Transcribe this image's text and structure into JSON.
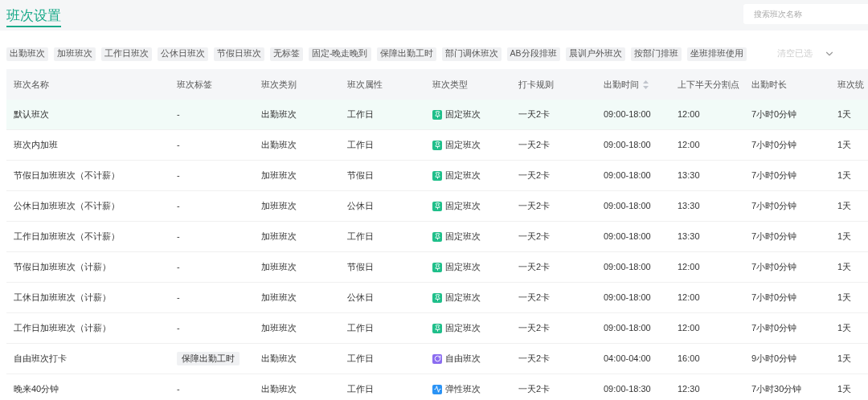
{
  "page_title": "班次设置",
  "search": {
    "placeholder": "搜索班次名称"
  },
  "filter_tags": [
    "出勤班次",
    "加班班次",
    "工作日班次",
    "公休日班次",
    "节假日班次",
    "无标签",
    "固定-晚走晚到",
    "保障出勤工时",
    "部门调休班次",
    "AB分段排班",
    "晨训户外班次",
    "按部门排班",
    "坐班排班使用"
  ],
  "clear_button": {
    "label": "清空已选",
    "disabled": true
  },
  "table": {
    "columns": [
      {
        "label": "班次名称",
        "sortable": false
      },
      {
        "label": "班次标签",
        "sortable": false
      },
      {
        "label": "班次类别",
        "sortable": false
      },
      {
        "label": "班次属性",
        "sortable": false
      },
      {
        "label": "班次类型",
        "sortable": false
      },
      {
        "label": "打卡规则",
        "sortable": false
      },
      {
        "label": "出勤时间",
        "sortable": true
      },
      {
        "label": "上下半天分割点",
        "sortable": false
      },
      {
        "label": "出勤时长",
        "sortable": false
      },
      {
        "label": "班次统",
        "sortable": false
      }
    ],
    "rows": [
      {
        "highlighted": true,
        "name": "默认班次",
        "tag": "-",
        "category": "出勤班次",
        "attribute": "工作日",
        "type": {
          "kind": "fixed",
          "label": "固定班次"
        },
        "rule": "一天2卡",
        "time": "09:00-18:00",
        "split": "12:00",
        "duration": "7小时0分钟",
        "stat": "1天"
      },
      {
        "highlighted": false,
        "name": "班次内加班",
        "tag": "-",
        "category": "出勤班次",
        "attribute": "工作日",
        "type": {
          "kind": "fixed",
          "label": "固定班次"
        },
        "rule": "一天2卡",
        "time": "09:00-18:00",
        "split": "12:00",
        "duration": "7小时0分钟",
        "stat": "1天"
      },
      {
        "highlighted": false,
        "name": "节假日加班班次（不计薪）",
        "tag": "-",
        "category": "加班班次",
        "attribute": "节假日",
        "type": {
          "kind": "fixed",
          "label": "固定班次"
        },
        "rule": "一天2卡",
        "time": "09:00-18:00",
        "split": "13:30",
        "duration": "7小时0分钟",
        "stat": "1天"
      },
      {
        "highlighted": false,
        "name": "公休日加班班次（不计薪）",
        "tag": "-",
        "category": "加班班次",
        "attribute": "公休日",
        "type": {
          "kind": "fixed",
          "label": "固定班次"
        },
        "rule": "一天2卡",
        "time": "09:00-18:00",
        "split": "13:30",
        "duration": "7小时0分钟",
        "stat": "1天"
      },
      {
        "highlighted": false,
        "name": "工作日加班班次（不计薪）",
        "tag": "-",
        "category": "加班班次",
        "attribute": "工作日",
        "type": {
          "kind": "fixed",
          "label": "固定班次"
        },
        "rule": "一天2卡",
        "time": "09:00-18:00",
        "split": "13:30",
        "duration": "7小时0分钟",
        "stat": "1天"
      },
      {
        "highlighted": false,
        "name": "节假日加班班次（计薪）",
        "tag": "-",
        "category": "加班班次",
        "attribute": "节假日",
        "type": {
          "kind": "fixed",
          "label": "固定班次"
        },
        "rule": "一天2卡",
        "time": "09:00-18:00",
        "split": "12:00",
        "duration": "7小时0分钟",
        "stat": "1天"
      },
      {
        "highlighted": false,
        "name": "工休日加班班次（计薪）",
        "tag": "-",
        "category": "加班班次",
        "attribute": "公休日",
        "type": {
          "kind": "fixed",
          "label": "固定班次"
        },
        "rule": "一天2卡",
        "time": "09:00-18:00",
        "split": "12:00",
        "duration": "7小时0分钟",
        "stat": "1天"
      },
      {
        "highlighted": false,
        "name": "工作日加班班次（计薪）",
        "tag": "-",
        "category": "加班班次",
        "attribute": "工作日",
        "type": {
          "kind": "fixed",
          "label": "固定班次"
        },
        "rule": "一天2卡",
        "time": "09:00-18:00",
        "split": "12:00",
        "duration": "7小时0分钟",
        "stat": "1天"
      },
      {
        "highlighted": false,
        "name": "自由班次打卡",
        "tag": "保障出勤工时",
        "category": "出勤班次",
        "attribute": "工作日",
        "type": {
          "kind": "free",
          "label": "自由班次"
        },
        "rule": "一天2卡",
        "time": "04:00-04:00",
        "split": "16:00",
        "duration": "9小时0分钟",
        "stat": "1天"
      },
      {
        "highlighted": false,
        "name": "晚来40分钟",
        "tag": "-",
        "category": "出勤班次",
        "attribute": "工作日",
        "type": {
          "kind": "flex",
          "label": "弹性班次"
        },
        "rule": "一天2卡",
        "time": "09:00-18:30",
        "split": "12:30",
        "duration": "7小时30分钟",
        "stat": "1天"
      }
    ]
  }
}
